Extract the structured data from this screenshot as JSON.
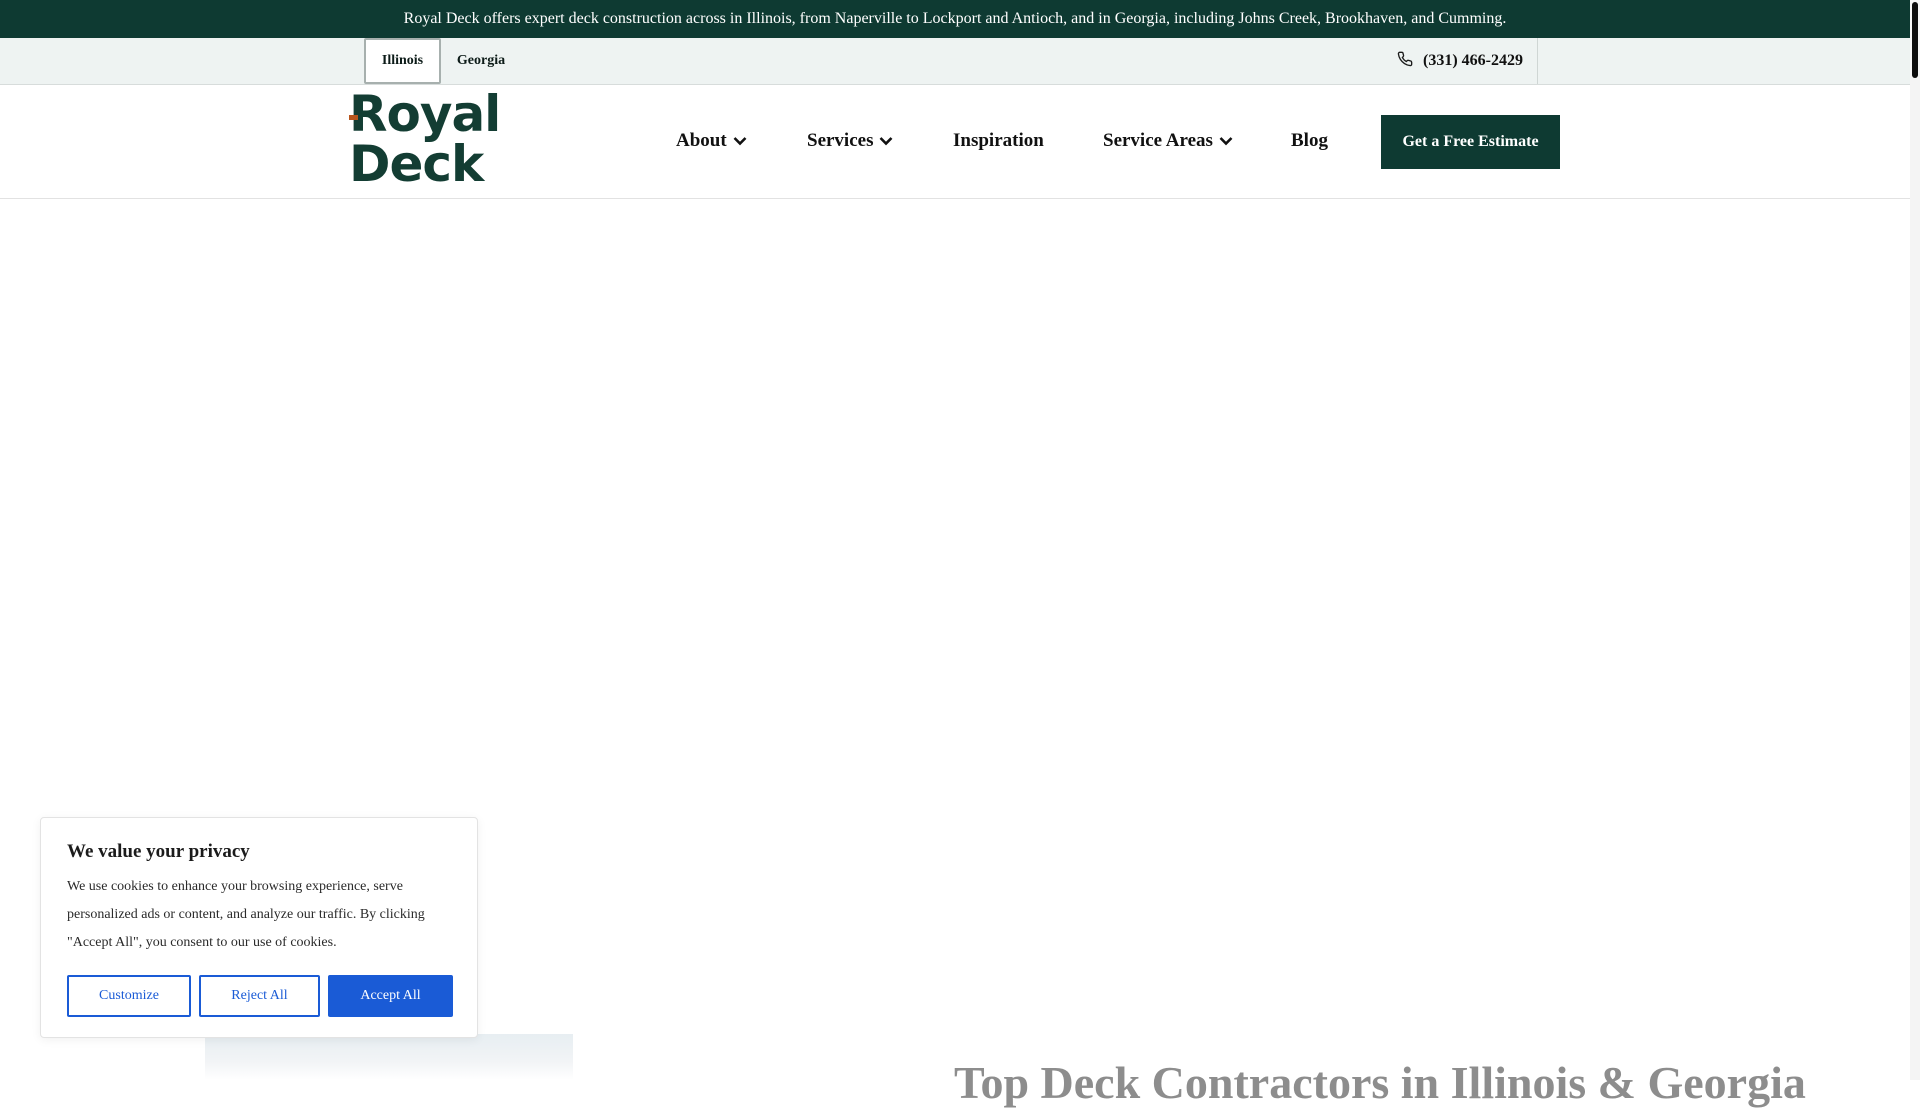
{
  "announcement": {
    "text": "Royal Deck offers expert deck construction across in Illinois, from Naperville to Lockport and Antioch, and in Georgia, including Johns Creek, Brookhaven, and Cumming."
  },
  "state_bar": {
    "tabs": [
      {
        "label": "Illinois",
        "active": true
      },
      {
        "label": "Georgia",
        "active": false
      }
    ],
    "phone": "(331) 466-2429",
    "phone_icon": "phone-icon"
  },
  "header": {
    "logo_text": "Royal Deck",
    "nav": [
      {
        "label": "About",
        "has_dropdown": true
      },
      {
        "label": "Services",
        "has_dropdown": true
      },
      {
        "label": "Inspiration",
        "has_dropdown": false
      },
      {
        "label": "Service Areas",
        "has_dropdown": true
      },
      {
        "label": "Blog",
        "has_dropdown": false
      }
    ],
    "cta_label": "Get a Free Estimate"
  },
  "hero": {
    "heading_partial": "Top Deck Contractors in Illinois & Georgia"
  },
  "cookie_banner": {
    "title": "We value your privacy",
    "body": "We use cookies to enhance your browsing experience, serve personalized ads or content, and analyze our traffic. By clicking \"Accept All\", you consent to our use of cookies.",
    "buttons": {
      "customize": "Customize",
      "reject": "Reject All",
      "accept": "Accept All"
    }
  },
  "colors": {
    "brand_dark_green": "#0e3a32",
    "accent_blue": "#1a5bd6",
    "logo_accent": "#b8561d"
  }
}
